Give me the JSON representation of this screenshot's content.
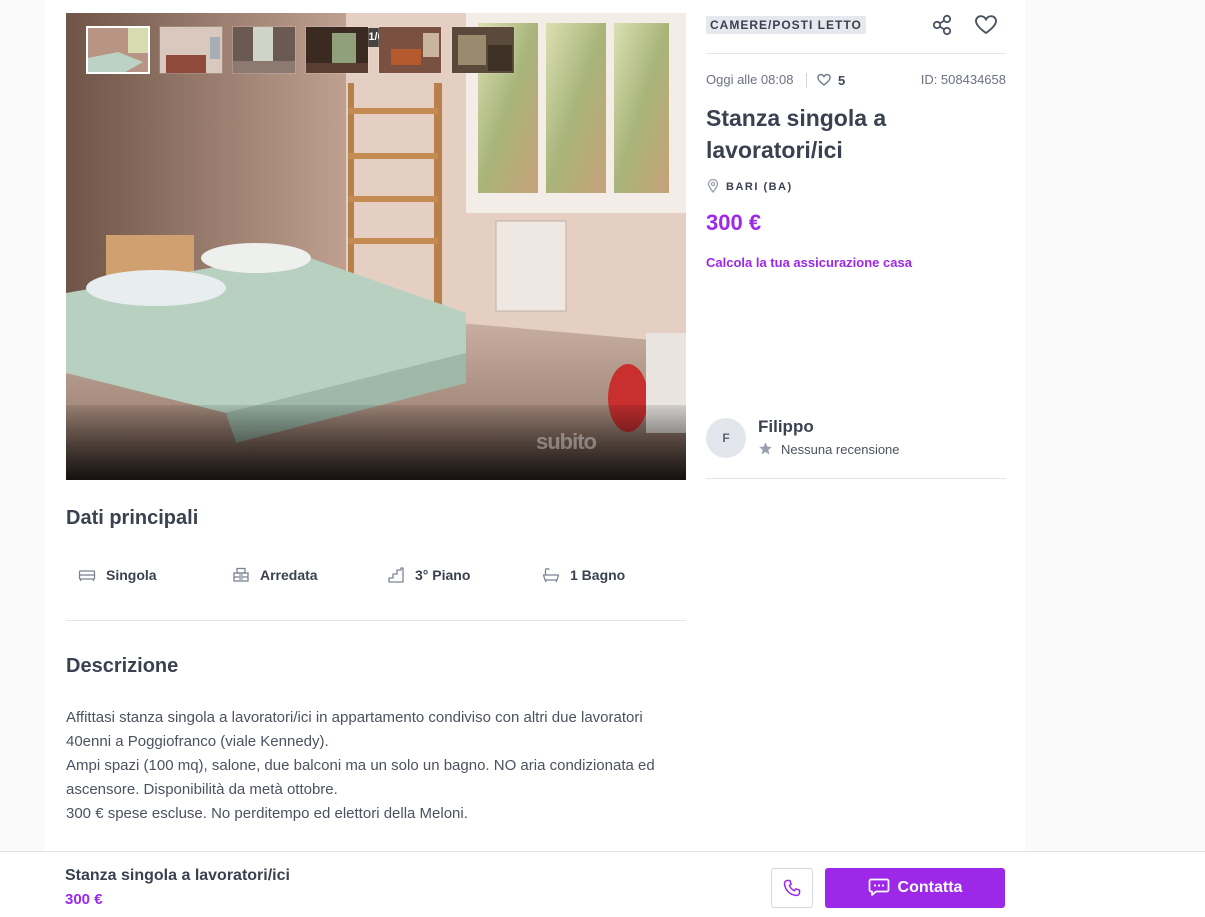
{
  "gallery": {
    "counter": "1/6",
    "watermark": "subito",
    "thumbnail_count": 6
  },
  "listing": {
    "category_badge": "CAMERE/POSTI LETTO",
    "posted": "Oggi alle 08:08",
    "likes": "5",
    "id_label": "ID: 508434658",
    "title": "Stanza singola a lavoratori/ici",
    "location": "BARI (BA)",
    "price": "300 €",
    "insurance_link": "Calcola la tua assicurazione casa"
  },
  "seller": {
    "initial": "F",
    "name": "Filippo",
    "reviews": "Nessuna recensione"
  },
  "main": {
    "key_data_title": "Dati principali",
    "features": [
      {
        "icon": "bed-icon",
        "label": "Singola"
      },
      {
        "icon": "furniture-icon",
        "label": "Arredata"
      },
      {
        "icon": "stairs-icon",
        "label": "3° Piano"
      },
      {
        "icon": "bathtub-icon",
        "label": "1 Bagno"
      }
    ],
    "description_title": "Descrizione",
    "description_lines": [
      "Affittasi stanza singola a lavoratori/ici in appartamento condiviso con altri due lavoratori",
      "40enni a Poggiofranco (viale Kennedy).",
      "Ampi spazi (100 mq), salone, due balconi ma un solo un bagno. NO aria condizionata ed",
      "ascensore. Disponibilità da metà ottobre.",
      "300 € spese escluse. No perditempo ed elettori della Meloni."
    ]
  },
  "bottom_bar": {
    "title": "Stanza singola a lavoratori/ici",
    "price": "300 €",
    "contact_label": "Contatta"
  },
  "colors": {
    "accent": "#9d28e8",
    "text": "#3a4150",
    "badge_bg": "#e7e8ee"
  }
}
